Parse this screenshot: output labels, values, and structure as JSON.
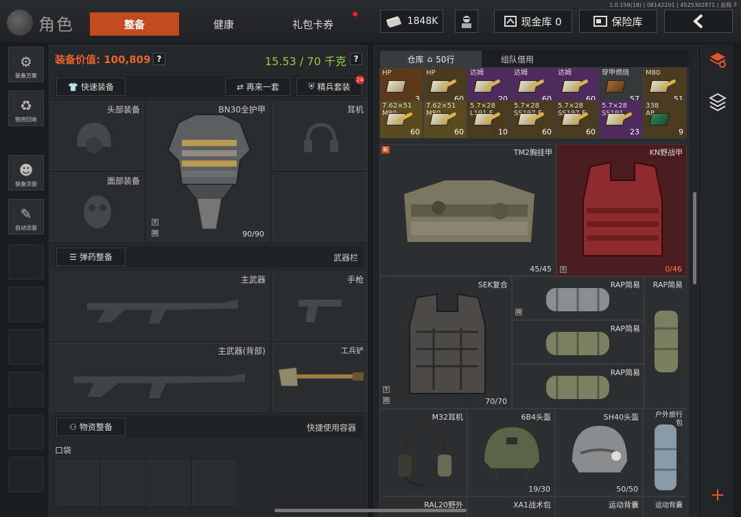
{
  "version": "1.0.159(18) | 08142201 | 4525302871 | 总局-7",
  "header": {
    "role_title": "角色",
    "tabs": [
      {
        "label": "整备",
        "active": true
      },
      {
        "label": "健康",
        "active": false
      },
      {
        "label": "礼包卡券",
        "active": false
      }
    ],
    "money": "1848K",
    "cash_vault": "现金库 0",
    "safe_box": "保险库",
    "colors": {
      "accent": "#c34a1c",
      "weight_green": "#8fd43a",
      "value_orange": "#e8642a"
    }
  },
  "left_nav": [
    {
      "label": "装备方案",
      "icon": "loadout-icon"
    },
    {
      "label": "物资回收",
      "icon": "recycle-icon"
    },
    {
      "label": "装备涂装",
      "icon": "soldier-paint-icon"
    },
    {
      "label": "自动涂装",
      "icon": "brush-icon"
    }
  ],
  "equip": {
    "value_label": "装备价值: 100,809",
    "weight_label": "15.53 / 70 千克",
    "help": "?",
    "quick_equip": "快速装备",
    "repeat_set": "再来一套",
    "elite_set": "精兵套装",
    "elite_badge": "24",
    "head": "头部装备",
    "armor_name": "BN30全护甲",
    "armor_durability": "90/90",
    "earphone": "耳机",
    "face": "面部装备",
    "ammo_btn": "弹药整备",
    "weapon_bar": "武器栏",
    "primary": "主武器",
    "pistol": "手枪",
    "primary_back": "主武器(背部)",
    "shovel": "工兵铲",
    "supply_btn": "物资整备",
    "quick_container": "快捷使用容器",
    "pocket": "口袋"
  },
  "storage": {
    "tab_warehouse": "仓库",
    "rows": "50行",
    "tab_team": "组队借用",
    "ammo_row1": [
      {
        "name": "HP",
        "count": "3",
        "bg": "#5a3a1a"
      },
      {
        "name": "HP",
        "count": "60",
        "bg": "#4a3a1f"
      },
      {
        "name": "达姆",
        "count": "20",
        "bg": "#4f2a5e"
      },
      {
        "name": "达姆",
        "count": "60",
        "bg": "#4f2a5e"
      },
      {
        "name": "达姆",
        "count": "60",
        "bg": "#4f2a5e"
      },
      {
        "name": "穿甲燃烧",
        "count": "57",
        "bg": "#373839"
      },
      {
        "name": "M80",
        "count": "51",
        "bg": "#4a3a1f"
      }
    ],
    "ammo_row2": [
      {
        "name": "7.62×51\nM80",
        "count": "60",
        "bg": "#5a4a1e"
      },
      {
        "name": "7.62×51\nM80",
        "count": "60",
        "bg": "#5a4a1e"
      },
      {
        "name": "5.7×28\nL191 F",
        "count": "10",
        "bg": "#4a3a1f"
      },
      {
        "name": "5.7×28\nSS197 F",
        "count": "60",
        "bg": "#4a3a1f"
      },
      {
        "name": "5.7×28\nSS197 F",
        "count": "60",
        "bg": "#4a3a1f"
      },
      {
        "name": "5.7×28\nSS191",
        "count": "23",
        "bg": "#4f2a5e"
      },
      {
        "name": "338\nAP",
        "count": "9",
        "bg": "#4a3a1f"
      }
    ],
    "new_tag": "新",
    "items": [
      {
        "name": "TM2胸挂甲",
        "dur": "45/45"
      },
      {
        "name": "KN野战甲",
        "dur": "0/46"
      },
      {
        "name": "SEK复合",
        "dur": "70/70"
      },
      {
        "name": "RAP简易",
        "dur": ""
      },
      {
        "name": "RAP简易",
        "dur": ""
      },
      {
        "name": "RAP简易",
        "dur": ""
      },
      {
        "name": "RAP简易",
        "dur": ""
      },
      {
        "name": "M32耳机",
        "dur": ""
      },
      {
        "name": "6B4头盔",
        "dur": "19/30"
      },
      {
        "name": "SH40头盔",
        "dur": "50/50"
      },
      {
        "name": "户外旅行包",
        "dur": ""
      },
      {
        "name": "RAL20野外",
        "dur": ""
      },
      {
        "name": "XA1战术包",
        "dur": ""
      },
      {
        "name": "运动背囊",
        "dur": ""
      },
      {
        "name": "运动背囊",
        "dur": ""
      }
    ]
  },
  "plus": "+"
}
